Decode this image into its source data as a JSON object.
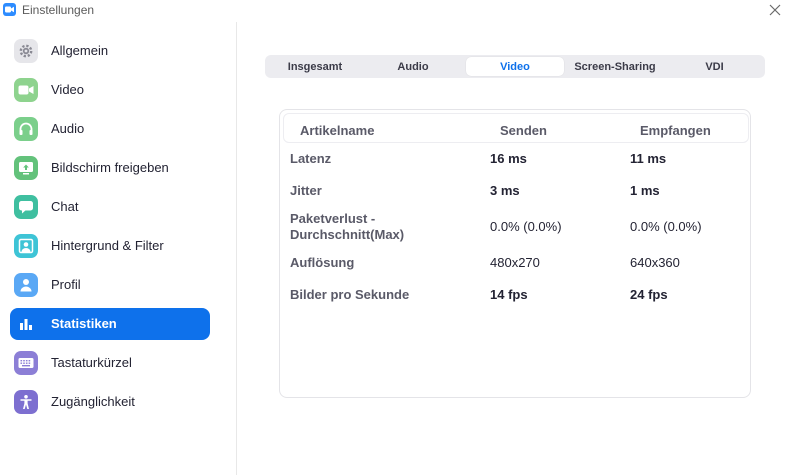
{
  "window": {
    "title": "Einstellungen"
  },
  "sidebar": {
    "items": [
      {
        "label": "Allgemein",
        "icon": "gear-icon",
        "color": "#e8e8ec"
      },
      {
        "label": "Video",
        "icon": "video-camera-icon",
        "color": "#8ed38e"
      },
      {
        "label": "Audio",
        "icon": "headphones-icon",
        "color": "#7bcf8b"
      },
      {
        "label": "Bildschirm freigeben",
        "icon": "share-screen-icon",
        "color": "#63c27b"
      },
      {
        "label": "Chat",
        "icon": "chat-bubble-icon",
        "color": "#3fbfa0"
      },
      {
        "label": "Hintergrund & Filter",
        "icon": "portrait-icon",
        "color": "#3ec4d6"
      },
      {
        "label": "Profil",
        "icon": "user-icon",
        "color": "#5aa8f5"
      },
      {
        "label": "Statistiken",
        "icon": "bar-chart-icon",
        "color": "#0e71eb",
        "active": true
      },
      {
        "label": "Tastaturkürzel",
        "icon": "keyboard-icon",
        "color": "#8c7fd6"
      },
      {
        "label": "Zugänglichkeit",
        "icon": "accessibility-icon",
        "color": "#7d6fd0"
      }
    ]
  },
  "tabs": [
    {
      "label": "Insgesamt"
    },
    {
      "label": "Audio"
    },
    {
      "label": "Video",
      "active": true
    },
    {
      "label": "Screen-Sharing"
    },
    {
      "label": "VDI"
    }
  ],
  "stats": {
    "headers": {
      "name": "Artikelname",
      "send": "Senden",
      "receive": "Empfangen"
    },
    "rows": [
      {
        "label": "Latenz",
        "send": "16 ms",
        "receive": "11 ms"
      },
      {
        "label": "Jitter",
        "send": "3 ms",
        "receive": "1 ms"
      },
      {
        "label": "Paketverlust - Durchschnitt(Max)",
        "send": "0.0% (0.0%)",
        "receive": "0.0% (0.0%)"
      },
      {
        "label": "Auflösung",
        "send": "480x270",
        "receive": "640x360"
      },
      {
        "label": "Bilder pro Sekunde",
        "send": "14 fps",
        "receive": "24 fps"
      }
    ]
  },
  "colors": {
    "accent": "#0e71eb",
    "text": "#232333"
  }
}
